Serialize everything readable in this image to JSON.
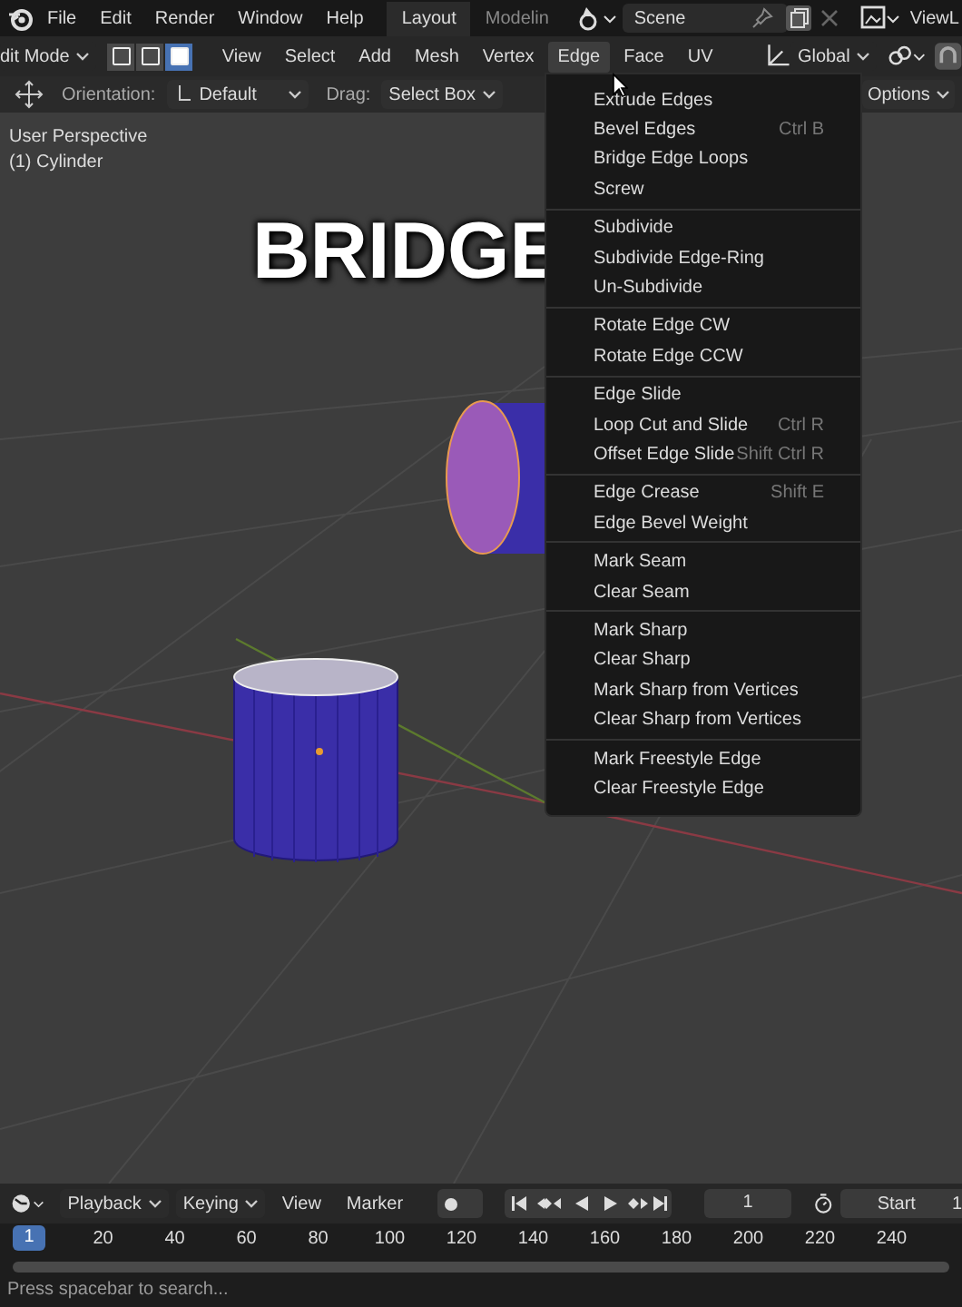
{
  "topbar": {
    "menus": [
      "File",
      "Edit",
      "Render",
      "Window",
      "Help"
    ],
    "workspaces": [
      {
        "label": "Layout",
        "selected": true
      },
      {
        "label": "Modelin",
        "selected": false
      }
    ],
    "scene": "Scene",
    "view_layer": "ViewL"
  },
  "header": {
    "mode": "dit Mode",
    "select_modes": [
      {
        "selected": false
      },
      {
        "selected": false
      },
      {
        "selected": true
      }
    ],
    "menus": [
      {
        "label": "View",
        "selected": false
      },
      {
        "label": "Select",
        "selected": false
      },
      {
        "label": "Add",
        "selected": false
      },
      {
        "label": "Mesh",
        "selected": false
      },
      {
        "label": "Vertex",
        "selected": false
      },
      {
        "label": "Edge",
        "selected": true
      },
      {
        "label": "Face",
        "selected": false
      },
      {
        "label": "UV",
        "selected": false
      }
    ],
    "orientation": "Global"
  },
  "tool_settings": {
    "orientation_label": "Orientation:",
    "orientation": "Default",
    "drag_label": "Drag:",
    "drag": "Select Box",
    "options": "Options"
  },
  "viewport": {
    "view_name": "User Perspective",
    "object": "(1) Cylinder",
    "caption": "BRIDGE"
  },
  "edge_menu": {
    "groups": [
      [
        {
          "label": "Extrude Edges"
        },
        {
          "label": "Bevel Edges",
          "shortcut": "Ctrl B"
        },
        {
          "label": "Bridge Edge Loops"
        },
        {
          "label": "Screw"
        }
      ],
      [
        {
          "label": "Subdivide"
        },
        {
          "label": "Subdivide Edge-Ring"
        },
        {
          "label": "Un-Subdivide"
        }
      ],
      [
        {
          "label": "Rotate Edge CW"
        },
        {
          "label": "Rotate Edge CCW"
        }
      ],
      [
        {
          "label": "Edge Slide"
        },
        {
          "label": "Loop Cut and Slide",
          "shortcut": "Ctrl R"
        },
        {
          "label": "Offset Edge Slide",
          "shortcut": "Shift Ctrl R"
        }
      ],
      [
        {
          "label": "Edge Crease",
          "shortcut": "Shift E"
        },
        {
          "label": "Edge Bevel Weight"
        }
      ],
      [
        {
          "label": "Mark Seam"
        },
        {
          "label": "Clear Seam"
        }
      ],
      [
        {
          "label": "Mark Sharp"
        },
        {
          "label": "Clear Sharp"
        },
        {
          "label": "Mark Sharp from Vertices"
        },
        {
          "label": "Clear Sharp from Vertices"
        }
      ],
      [
        {
          "label": "Mark Freestyle Edge"
        },
        {
          "label": "Clear Freestyle Edge"
        }
      ]
    ]
  },
  "timeline": {
    "menus": [
      "Playback",
      "Keying"
    ],
    "items": [
      "View",
      "Marker"
    ],
    "current_frame": "1",
    "start_label": "Start",
    "start_value": "1",
    "ruler": {
      "current": "1",
      "ticks": [
        "20",
        "40",
        "60",
        "80",
        "100",
        "120",
        "140",
        "160",
        "180",
        "200",
        "220",
        "240"
      ]
    }
  },
  "status_bar": "Press spacebar to search..."
}
